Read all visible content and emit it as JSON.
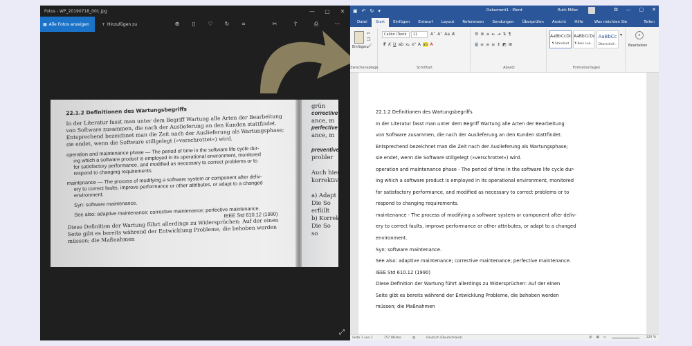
{
  "photos": {
    "title": "Fotos - WP_20190718_001.jpg",
    "window_controls": [
      "—",
      "▢",
      "✕"
    ],
    "toolbar": {
      "see_all_label": "Alle Fotos anzeigen",
      "add_label": "Hinzufügen zu"
    },
    "photo": {
      "heading": "22.1.2  Definitionen des Wartungsbegriffs",
      "lines": [
        {
          "style": "serif",
          "text": "In der Literatur fasst man unter dem Begriff Wartung alle Arten der Bearbeitung"
        },
        {
          "style": "serif",
          "text": "von Software zusammen, die nach der Auslieferung an den Kunden stattfindet."
        },
        {
          "style": "serif",
          "text": "Entsprechend bezeichnet man die Zeit nach der Auslieferung als Wartungsphase;"
        },
        {
          "style": "serif",
          "text": "sie endet, wenn die Software stillgelegt (»verschrottet«) wird."
        },
        {
          "style": "gap",
          "text": ""
        },
        {
          "style": "sans",
          "text": "operation and maintenance phase — The period of time in the software life cycle dur-"
        },
        {
          "style": "sans-indent",
          "text": "ing which a software product is employed in its operational environment, monitored"
        },
        {
          "style": "sans-indent",
          "text": "for satisfactory performance, and modified as necessary to correct problems or to"
        },
        {
          "style": "sans-indent",
          "text": "respond to changing requirements."
        },
        {
          "style": "gap",
          "text": ""
        },
        {
          "style": "sans",
          "text": "maintenance — The process of modifying a software system or component after deliv-"
        },
        {
          "style": "sans-indent",
          "text": "ery to correct faults, improve performance or other attributes, or adapt to a changed"
        },
        {
          "style": "sans-indent",
          "text": "environment."
        },
        {
          "style": "gap",
          "text": ""
        },
        {
          "style": "sans-indent",
          "text": "Syn: software maintenance."
        },
        {
          "style": "gap",
          "text": ""
        },
        {
          "style": "sans-indent",
          "text": "See also: adaptive maintenance; corrective maintenance; perfective maintenance."
        },
        {
          "style": "sans-right",
          "text": "IEEE Std 610.12 (1990)"
        },
        {
          "style": "serif",
          "text": "Diese Definition der Wartung führt allerdings zu Widersprüchen: Auf der einen"
        },
        {
          "style": "serif",
          "text": "Seite gibt es bereits während der Entwicklung Probleme, die behoben werden"
        },
        {
          "style": "serif",
          "text": "müssen; die Maßnahmen"
        }
      ],
      "right_page_lines": [
        {
          "style": "serif",
          "text": "grün"
        },
        {
          "style": "bold",
          "text": "corrective"
        },
        {
          "style": "serif",
          "text": "ance, m"
        },
        {
          "style": "bold",
          "text": "perfective"
        },
        {
          "style": "serif",
          "text": "ance, m"
        },
        {
          "style": "serif",
          "text": ""
        },
        {
          "style": "bold",
          "text": "preventive"
        },
        {
          "style": "serif",
          "text": "probler"
        },
        {
          "style": "serif",
          "text": ""
        },
        {
          "style": "serif",
          "text": "Auch hier"
        },
        {
          "style": "serif",
          "text": "korrektiv"
        },
        {
          "style": "serif",
          "text": ""
        },
        {
          "style": "serif",
          "text": "a)  Adapt"
        },
        {
          "style": "serif",
          "text": "Die So"
        },
        {
          "style": "serif",
          "text": "erfüllt"
        },
        {
          "style": "serif",
          "text": "b)  Korrek"
        },
        {
          "style": "serif",
          "text": "Die So"
        },
        {
          "style": "serif",
          "text": "so"
        }
      ]
    }
  },
  "word": {
    "title": "Dokument1 - Word",
    "user": "Ruth Miller",
    "tabs": [
      "Datei",
      "Start",
      "Einfügen",
      "Entwurf",
      "Layout",
      "Referenzen",
      "Sendungen",
      "Überprüfen",
      "Ansicht",
      "Hilfe"
    ],
    "active_tab": "Start",
    "search_label": "Was möchten Sie tun?",
    "share_label": "Teilen",
    "ribbon": {
      "paste_label": "Einfügen",
      "clipboard_label": "Zwischenablage",
      "font_name": "Calibri (Textk",
      "font_size": "11",
      "font_label": "Schriftart",
      "paragraph_label": "Absatz",
      "styles_label": "Formatvorlagen",
      "styles": [
        {
          "sample": "AaBbCcDc",
          "name": "¶ Standard"
        },
        {
          "sample": "AaBbCcDc",
          "name": "¶ Kein Lee..."
        },
        {
          "sample": "AaBbCc",
          "name": "Überschrif..."
        }
      ],
      "edit_label": "Bearbeiten"
    },
    "document_lines": [
      "22.1.2 Definitionen des Wartungsbegriffs",
      "In der Literatur fasst man unter dem Begriff Wartung alle Arten der Bearbeitung",
      "von Software zusammen, die nach der Auslieferung an den Kunden stattfindet.",
      "Entsprechend bezeichnet man die Zeit nach der Auslieferung als Wartungsphase;",
      "sie endet, wenn die Software stillgelegt (»verschrottet«) wird.",
      "operation and maintenance phase - The period of time in the software life cycle dur-",
      "ing which a software product is employed in its operational environment, monitored",
      "for satisfactory performance, and modified as necessary to correct problems or to",
      "respond to changing requirements.",
      "maintenance - The process of modifying a software system or component after deliv-",
      "ery to correct faults, improve performance or other attributes, or adapt to a changed",
      "environment.",
      "Syn: software maintenance.",
      "See also: adaptive maintenance; corrective maintenance; perfective maintenance.",
      "IEEE Std 610.12 (1990)",
      "Diese Definition der Wartung führt allerdings zu Widersprüchen: Auf der einen",
      "Seite gibt es bereits während der Entwicklung Probleme, die behoben werden",
      "müssen; die Maßnahmen"
    ],
    "status": {
      "page": "Seite 1 von 1",
      "words": "157 Wörter",
      "language": "Deutsch (Deutschland)",
      "zoom": "120 %"
    }
  },
  "colors": {
    "photos_accent": "#1a73c8",
    "word_blue": "#2b579a",
    "arrow": "#8a7f5e"
  }
}
